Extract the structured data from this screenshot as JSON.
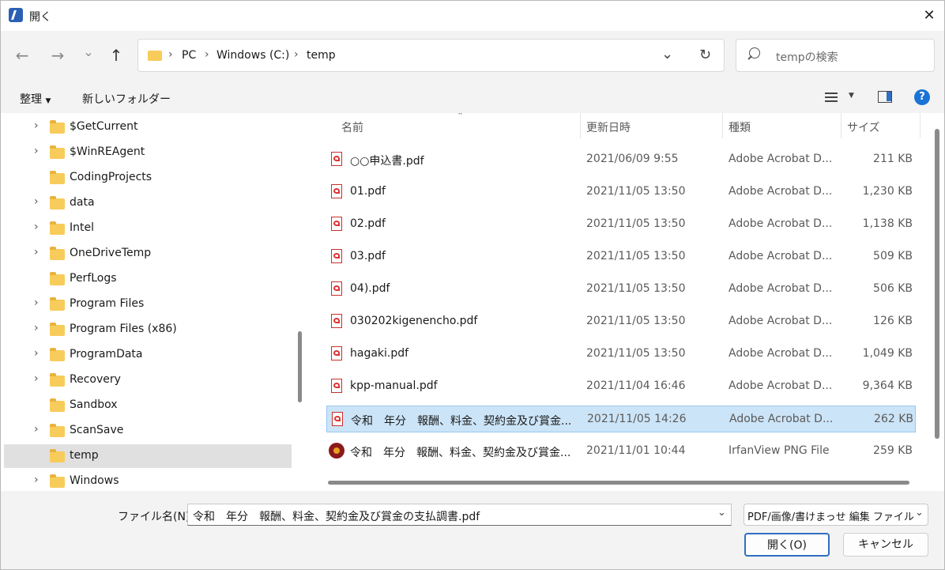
{
  "window": {
    "title": "開く",
    "close_glyph": "✕"
  },
  "nav": {
    "back_glyph": "←",
    "forward_glyph": "→",
    "recent_glyph": "⌄",
    "up_glyph": "↑",
    "breadcrumb": [
      "PC",
      "Windows (C:)",
      "temp"
    ],
    "refresh_glyph": "↻",
    "dropdown_glyph": "⌄"
  },
  "search": {
    "placeholder": "tempの検索"
  },
  "toolbar": {
    "organize": "整理",
    "new_folder": "新しいフォルダー"
  },
  "sidebar": {
    "items": [
      {
        "label": "$GetCurrent",
        "expandable": true
      },
      {
        "label": "$WinREAgent",
        "expandable": true
      },
      {
        "label": "CodingProjects",
        "expandable": false
      },
      {
        "label": "data",
        "expandable": true
      },
      {
        "label": "Intel",
        "expandable": true
      },
      {
        "label": "OneDriveTemp",
        "expandable": true
      },
      {
        "label": "PerfLogs",
        "expandable": false
      },
      {
        "label": "Program Files",
        "expandable": true
      },
      {
        "label": "Program Files (x86)",
        "expandable": true
      },
      {
        "label": "ProgramData",
        "expandable": true
      },
      {
        "label": "Recovery",
        "expandable": true
      },
      {
        "label": "Sandbox",
        "expandable": false
      },
      {
        "label": "ScanSave",
        "expandable": true
      },
      {
        "label": "temp",
        "expandable": false,
        "selected": true
      },
      {
        "label": "Windows",
        "expandable": true
      }
    ]
  },
  "columns": {
    "name": "名前",
    "date": "更新日時",
    "type": "種類",
    "size": "サイズ"
  },
  "files": [
    {
      "name": "○○申込書.pdf",
      "date": "2021/06/09 9:55",
      "type": "Adobe Acrobat D...",
      "size": "211 KB",
      "icon": "pdf-icon"
    },
    {
      "name": "01.pdf",
      "date": "2021/11/05 13:50",
      "type": "Adobe Acrobat D...",
      "size": "1,230 KB",
      "icon": "pdf-icon"
    },
    {
      "name": "02.pdf",
      "date": "2021/11/05 13:50",
      "type": "Adobe Acrobat D...",
      "size": "1,138 KB",
      "icon": "pdf-icon"
    },
    {
      "name": "03.pdf",
      "date": "2021/11/05 13:50",
      "type": "Adobe Acrobat D...",
      "size": "509 KB",
      "icon": "pdf-icon"
    },
    {
      "name": "04).pdf",
      "date": "2021/11/05 13:50",
      "type": "Adobe Acrobat D...",
      "size": "506 KB",
      "icon": "pdf-icon"
    },
    {
      "name": "030202kigenencho.pdf",
      "date": "2021/11/05 13:50",
      "type": "Adobe Acrobat D...",
      "size": "126 KB",
      "icon": "pdf-icon"
    },
    {
      "name": "hagaki.pdf",
      "date": "2021/11/05 13:50",
      "type": "Adobe Acrobat D...",
      "size": "1,049 KB",
      "icon": "pdf-icon"
    },
    {
      "name": "kpp-manual.pdf",
      "date": "2021/11/04 16:46",
      "type": "Adobe Acrobat D...",
      "size": "9,364 KB",
      "icon": "pdf-icon"
    },
    {
      "name": "令和　年分　報酬、料金、契約金及び賞金...",
      "date": "2021/11/05 14:26",
      "type": "Adobe Acrobat D...",
      "size": "262 KB",
      "icon": "pdf-icon",
      "selected": true
    },
    {
      "name": "令和　年分　報酬、料金、契約金及び賞金...",
      "date": "2021/11/01 10:44",
      "type": "IrfanView PNG File",
      "size": "259 KB",
      "icon": "png-icon"
    }
  ],
  "bottom": {
    "filename_label": "ファイル名(N):",
    "filename_value": "令和　年分　報酬、料金、契約金及び賞金の支払調書.pdf",
    "filter_value": "PDF/画像/書けまっせ 編集 ファイル",
    "open_label": "開く(O)",
    "cancel_label": "キャンセル"
  },
  "colors": {
    "selection": "#cce4f7",
    "accent": "#2f6fc1"
  }
}
